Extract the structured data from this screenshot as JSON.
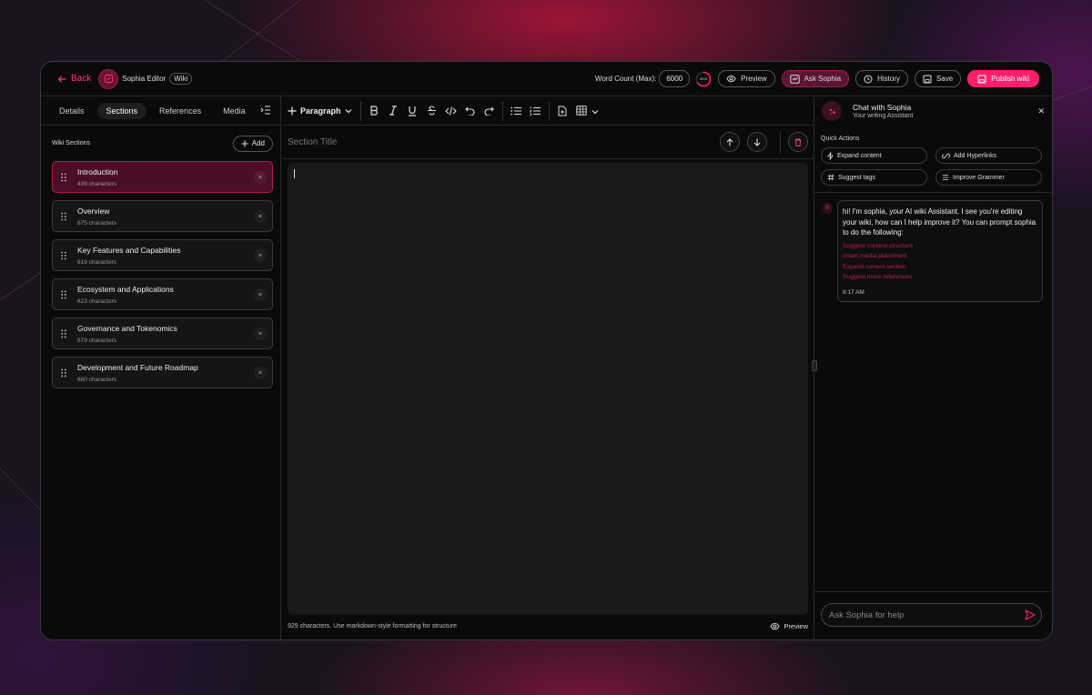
{
  "header": {
    "back_label": "Back",
    "brand": "Sophia Editor",
    "tag": "Wiki",
    "word_count_label": "Word Count (Max):",
    "word_count_max": "6000",
    "progress_percent": 65,
    "progress_label": "65%",
    "preview_label": "Preview",
    "ask_label": "Ask Sophia",
    "history_label": "History",
    "save_label": "Save",
    "publish_label": "Publish wiki"
  },
  "tabs": [
    {
      "label": "Details"
    },
    {
      "label": "Sections",
      "active": true
    },
    {
      "label": "References"
    },
    {
      "label": "Media"
    }
  ],
  "sections_panel": {
    "title": "Wiki Sections",
    "add_label": "Add",
    "items": [
      {
        "title": "Introduction",
        "chars": "439 characters",
        "active": true
      },
      {
        "title": "Overview",
        "chars": "675 characters"
      },
      {
        "title": "Key Features and Capabilities",
        "chars": "619 characters"
      },
      {
        "title": "Ecosystem and Applications",
        "chars": "623 characters"
      },
      {
        "title": "Governance and Tokenomics",
        "chars": "579 characters"
      },
      {
        "title": "Development and Future Roadmap",
        "chars": "680 characters"
      }
    ]
  },
  "editor": {
    "paragraph_label": "Paragraph",
    "section_title_placeholder": "Section Title",
    "footer_text": "929 characters. Use markdown-style formatting for structure",
    "preview_label": "Preview"
  },
  "chat": {
    "title": "Chat with Sophia",
    "subtitle": "Your writing Assistant",
    "quick_actions_label": "Quick Actions",
    "quick_actions": [
      {
        "label": "Expand content",
        "icon": "lightning-icon"
      },
      {
        "label": "Add Hyperlinks",
        "icon": "link-icon"
      },
      {
        "label": "Suggest tags",
        "icon": "hash-icon"
      },
      {
        "label": "Improve Grammer",
        "icon": "lines-icon"
      }
    ],
    "avatar_letter": "S",
    "message": "hi! I'm sophia, your AI wiki Assistant. I see you're editing your wiki, how can I help improve it? You can prompt sophia to do the following:",
    "suggestions": [
      "Suggest content structure",
      "smart media placement",
      "Expand current section",
      "Suggest more references"
    ],
    "time": "8:17 AM",
    "input_placeholder": "Ask Sophia for help"
  },
  "colors": {
    "accent": "#ff1f6d",
    "link": "#c21e5a",
    "active_item_bg": "#4a0f26"
  }
}
